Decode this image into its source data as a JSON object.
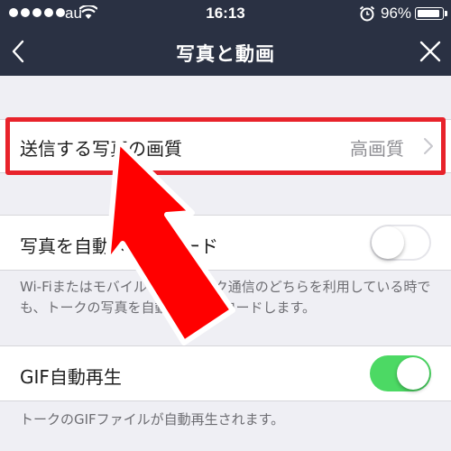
{
  "status_bar": {
    "carrier": "au",
    "time": "16:13",
    "battery_percent": "96%",
    "battery_level": 0.96,
    "signal_bars": 5
  },
  "nav": {
    "title": "写真と動画",
    "back_icon": "chevron-left-icon",
    "close_icon": "close-icon"
  },
  "settings": {
    "photo_quality": {
      "label": "送信する写真の画質",
      "value": "高画質"
    },
    "auto_download": {
      "label": "写真を自動ダウンロード",
      "enabled": false,
      "description": "Wi-Fiまたはモバイルネットワーク通信のどちらを利用している時でも、トークの写真を自動でダウンロードします。"
    },
    "gif_autoplay": {
      "label": "GIF自動再生",
      "enabled": true,
      "description": "トークのGIFファイルが自動再生されます。"
    }
  },
  "colors": {
    "nav_background": "#2a3143",
    "highlight": "#e8232b",
    "toggle_on": "#4cd964"
  }
}
